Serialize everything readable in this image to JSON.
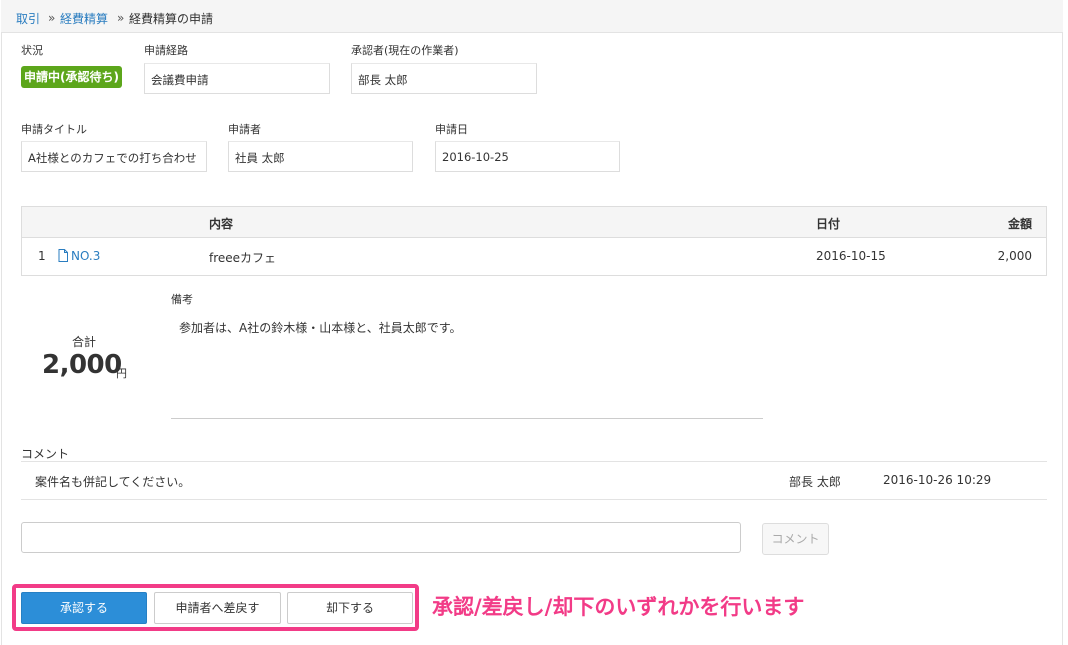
{
  "breadcrumb": {
    "item1": "取引",
    "item2": "経費精算",
    "current": "経費精算の申請",
    "separator": "»"
  },
  "fields": {
    "status_label": "状況",
    "status_value": "申請中(承認待ち)",
    "route_label": "申請経路",
    "route_value": "会議費申請",
    "approver_label": "承認者(現在の作業者)",
    "approver_value": "部長 太郎",
    "title_label": "申請タイトル",
    "title_value": "A社様とのカフェでの打ち合わせ",
    "applicant_label": "申請者",
    "applicant_value": "社員 太郎",
    "date_label": "申請日",
    "date_value": "2016-10-25"
  },
  "table": {
    "headers": [
      "内容",
      "日付",
      "金額"
    ],
    "rows": [
      {
        "no": "1",
        "receipt": "NO.3",
        "content": "freeeカフェ",
        "date": "2016-10-15",
        "amount": "2,000"
      }
    ]
  },
  "total": {
    "label": "合計",
    "value": "2,000",
    "unit": "円"
  },
  "notes": {
    "label": "備考",
    "text": "参加者は、A社の鈴木様・山本様と、社員太郎です。"
  },
  "comments": {
    "label": "コメント",
    "items": [
      {
        "text": "案件名も併記してください。",
        "author": "部長 太郎",
        "datetime": "2016-10-26 10:29"
      }
    ],
    "input_placeholder": "",
    "submit_label": "コメント"
  },
  "actions": {
    "approve": "承認する",
    "return": "申請者へ差戻す",
    "reject": "却下する"
  },
  "annotation": "承認/差戻し/却下のいずれかを行います",
  "colors": {
    "status_badge": "#5ca61b",
    "primary_button": "#2c8ed8",
    "link": "#2a7dc0",
    "annotation": "#f23b87"
  }
}
